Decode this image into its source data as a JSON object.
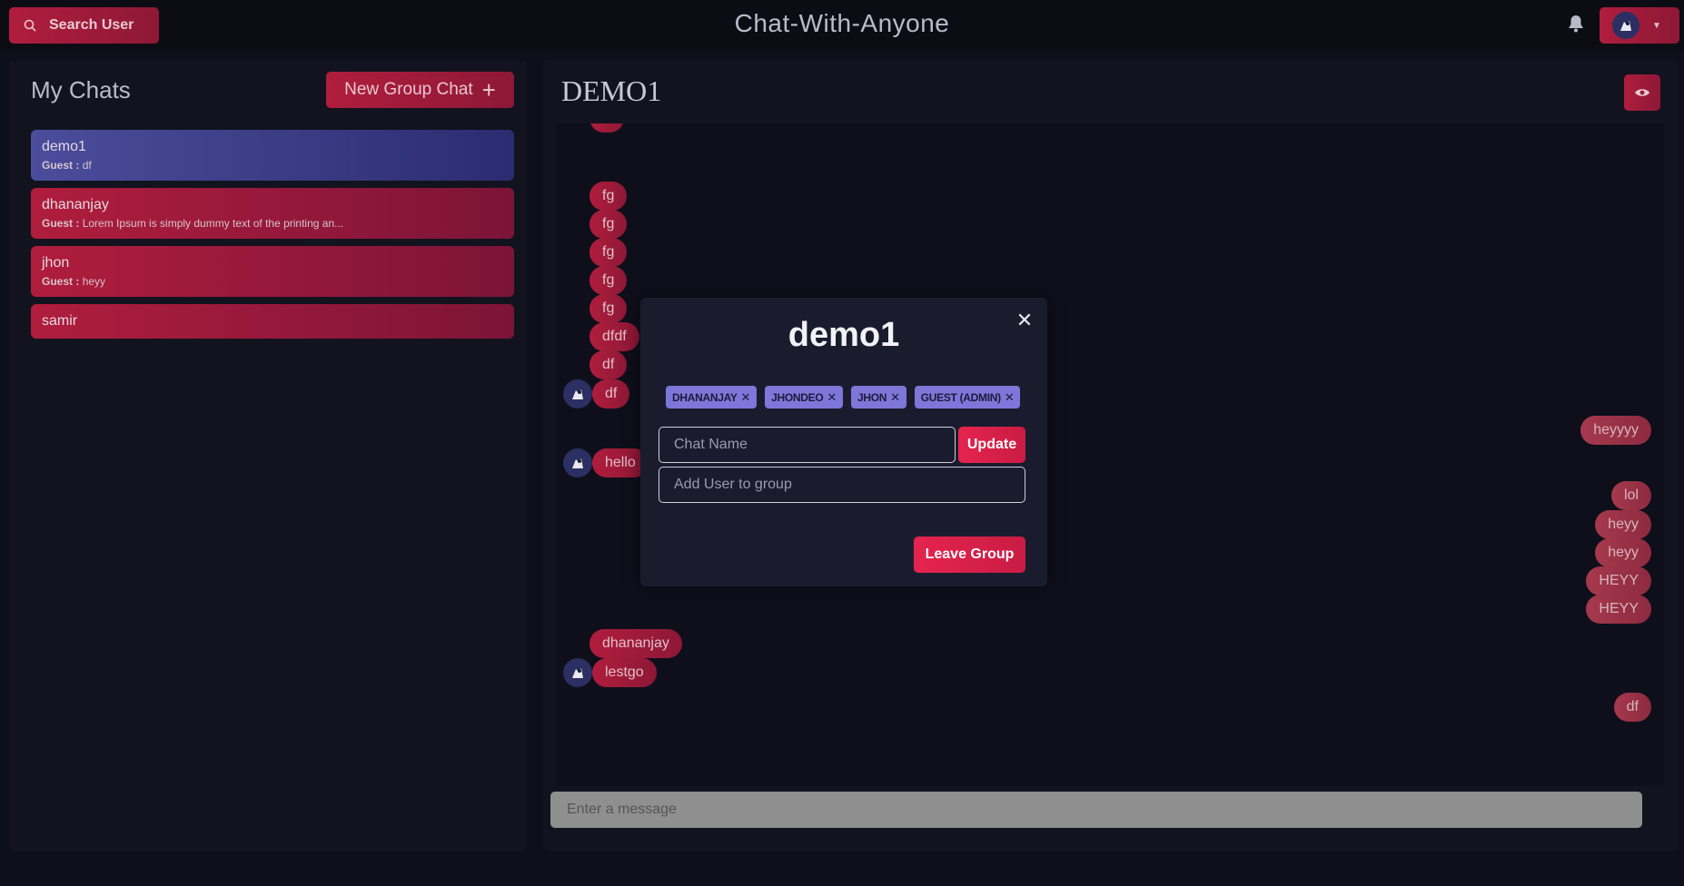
{
  "header": {
    "search_label": "Search User",
    "app_title": "Chat-With-Anyone"
  },
  "sidebar": {
    "title": "My Chats",
    "new_group_label": "New Group Chat",
    "chats": [
      {
        "name": "demo1",
        "sender": "Guest :",
        "preview": "df",
        "active": true
      },
      {
        "name": "dhananjay",
        "sender": "Guest :",
        "preview": "Lorem Ipsum is simply dummy text of the printing an...",
        "active": false
      },
      {
        "name": "jhon",
        "sender": "Guest :",
        "preview": "heyy",
        "active": false
      },
      {
        "name": "samir",
        "sender": "",
        "preview": "",
        "active": false
      }
    ]
  },
  "main": {
    "chat_title": "DEMO1",
    "messages": [
      {
        "text": "fg",
        "side": "left"
      },
      {
        "text": "fg",
        "side": "left"
      },
      {
        "text": "fg",
        "side": "left"
      },
      {
        "text": "fg",
        "side": "left"
      },
      {
        "text": "fg",
        "side": "left"
      },
      {
        "text": "dfdf",
        "side": "left"
      },
      {
        "text": "df",
        "side": "left"
      },
      {
        "text": "df",
        "side": "left",
        "avatar": true
      },
      {
        "text": "heyyyy",
        "side": "right"
      },
      {
        "text": "hello",
        "side": "left",
        "avatar": true
      },
      {
        "text": "lol",
        "side": "right"
      },
      {
        "text": "heyy",
        "side": "right"
      },
      {
        "text": "heyy",
        "side": "right"
      },
      {
        "text": "HEYY",
        "side": "right"
      },
      {
        "text": "HEYY",
        "side": "right"
      },
      {
        "text": "dhananjay",
        "side": "left"
      },
      {
        "text": "lestgo",
        "side": "left",
        "avatar": true
      },
      {
        "text": "df",
        "side": "right"
      }
    ],
    "message_placeholder": "Enter a message"
  },
  "modal": {
    "title": "demo1",
    "members": [
      "DHANANJAY",
      "JHONDEO",
      "JHON",
      "GUEST (ADMIN)"
    ],
    "chat_name_placeholder": "Chat Name",
    "update_label": "Update",
    "add_user_placeholder": "Add User to group",
    "leave_label": "Leave Group"
  },
  "colors": {
    "accent": "#b01d3d",
    "active_chat": "#4b4d9c",
    "badge": "#7e76d9",
    "modal_button": "#e5244e"
  }
}
